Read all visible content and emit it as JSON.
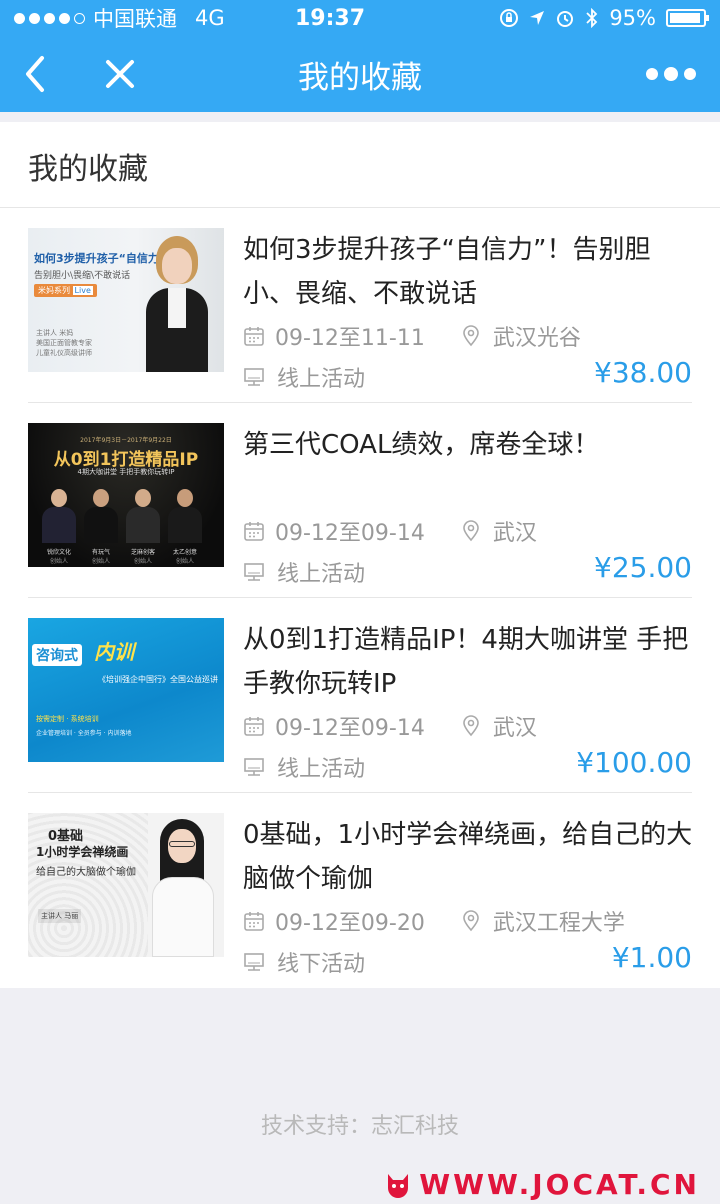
{
  "status_bar": {
    "carrier": "中国联通",
    "network": "4G",
    "time": "19:37",
    "battery": "95%",
    "battery_level": 0.95,
    "icons": [
      "lock-rotation-icon",
      "location-arrow-icon",
      "alarm-icon",
      "bluetooth-icon",
      "battery-icon"
    ]
  },
  "nav": {
    "title": "我的收藏",
    "icons": [
      "back-arrow-icon",
      "close-icon",
      "more-icon"
    ]
  },
  "section_title": "我的收藏",
  "items": [
    {
      "title": "如何3步提升孩子“自信力”！告别胆小、畏缩、不敢说话",
      "date": "09-12至11-11",
      "location": "武汉光谷",
      "mode": "线上活动",
      "price": "¥38.00",
      "thumb": {
        "headline": "如何3步提升孩子“自信力”",
        "subline": "告别胆小\\畏缩\\不敢说话",
        "tag": "米妈系列",
        "tag_badge": "Live",
        "host": "主讲人 米妈",
        "host_desc1": "美国正面管教专家",
        "host_desc2": "儿童礼仪高级讲师"
      }
    },
    {
      "title": "第三代COAL绩效，席卷全球！",
      "date": "09-12至09-14",
      "location": "武汉",
      "mode": "线上活动",
      "price": "¥25.00",
      "thumb": {
        "dates": "2017年9月3日－2017年9月22日",
        "headline": "从0到1打造精品IP",
        "subline": "4期大咖讲堂 手把手教你玩转IP",
        "people": [
          "锐欣文化",
          "有玩气",
          "芝麻创客",
          "太乙创意"
        ],
        "people_role": [
          "创始人",
          "创始人",
          "创始人",
          "创始人"
        ]
      }
    },
    {
      "title": "从0到1打造精品IP！4期大咖讲堂 手把手教你玩转IP",
      "date": "09-12至09-14",
      "location": "武汉",
      "mode": "线上活动",
      "price": "¥100.00",
      "thumb": {
        "headline_a": "咨询式",
        "headline_b": "内训",
        "tagline": "《培训强企中国行》全国公益巡讲",
        "small1": "按需定制 · 系统培训",
        "small2": "企业管理培训 · 全员参与 · 内训落地"
      }
    },
    {
      "title": "0基础，1小时学会禅绕画，给自己的大脑做个瑜伽",
      "date": "09-12至09-20",
      "location": "武汉工程大学",
      "mode": "线下活动",
      "price": "¥1.00",
      "thumb": {
        "headline_a": "0基础",
        "headline_b": "1小时学会禅绕画",
        "subline": "给自己的大脑做个瑜伽",
        "host": "主讲人 马丽"
      }
    }
  ],
  "footer": "技术支持：志汇科技",
  "watermark": "WWW.JOCAT.CN"
}
